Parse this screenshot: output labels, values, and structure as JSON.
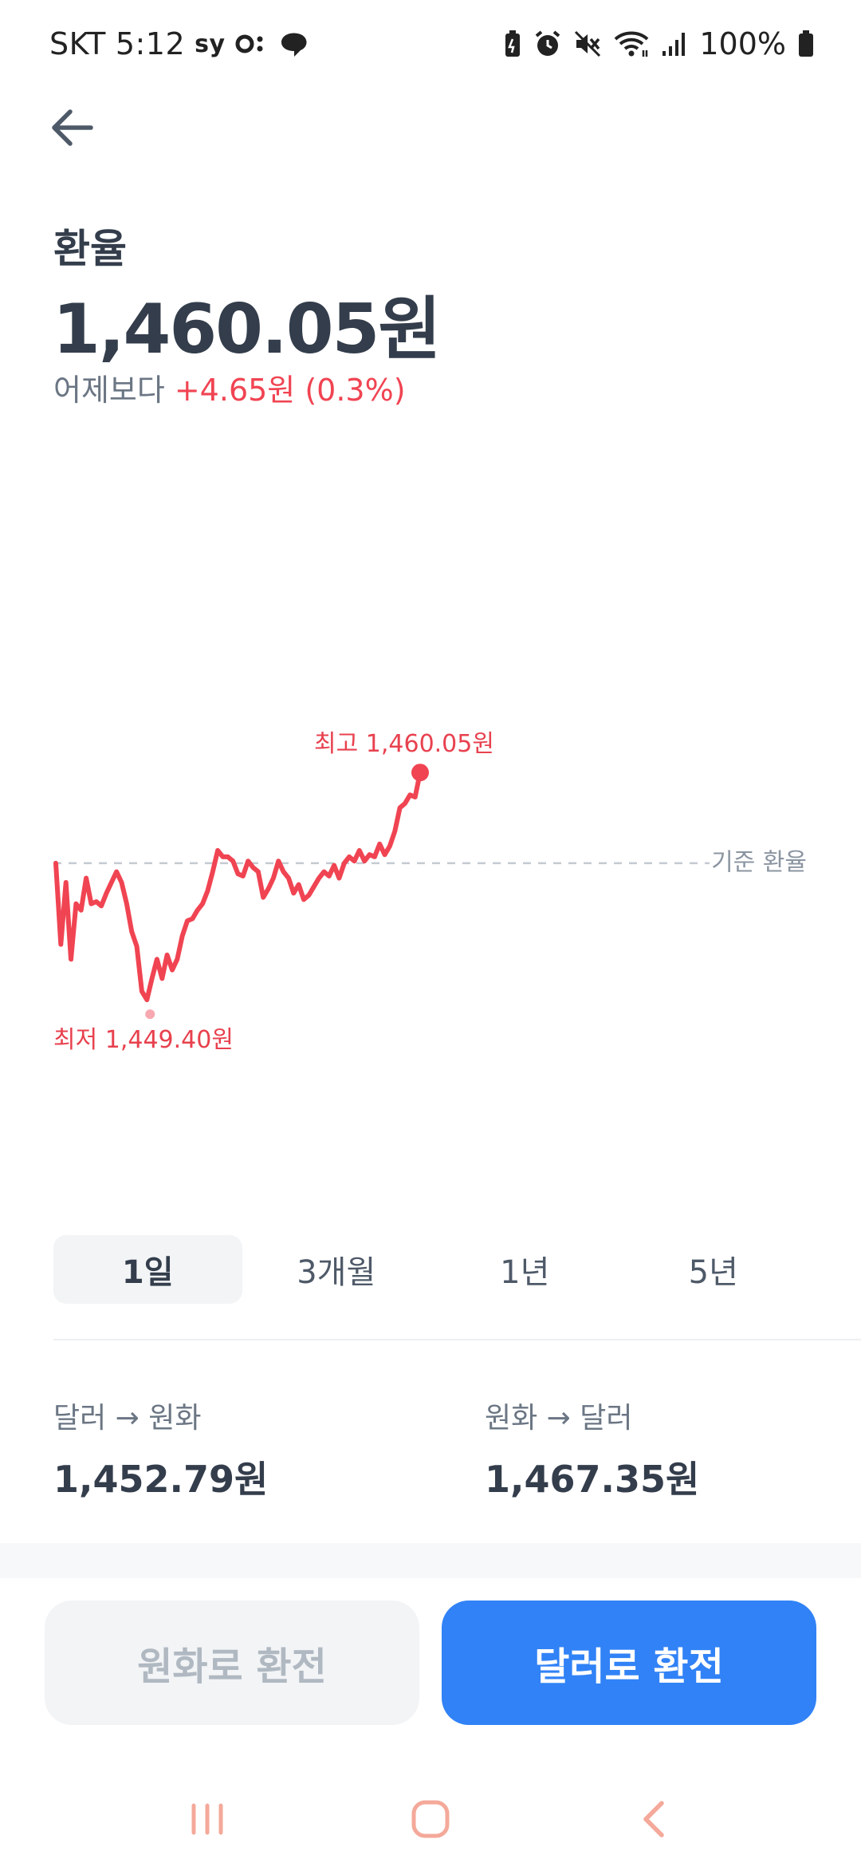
{
  "status_bar": {
    "carrier": "SKT",
    "time": "5:12",
    "left_badges": "sy",
    "battery": "100%"
  },
  "header": {
    "label": "환율",
    "rate": "1,460.05원",
    "change_prefix": "어제보다",
    "change_value": "+4.65원 (0.3%)"
  },
  "chart_data": {
    "type": "line",
    "series": [
      {
        "values": [
          1455.8,
          1452.0,
          1454.9,
          1451.3,
          1453.9,
          1453.6,
          1455.1,
          1453.9,
          1454.0,
          1453.8,
          1454.4,
          1454.9,
          1455.4,
          1454.9,
          1453.9,
          1452.6,
          1451.9,
          1449.8,
          1449.4,
          1450.4,
          1451.3,
          1450.4,
          1451.5,
          1450.8,
          1451.3,
          1452.4,
          1453.1,
          1453.2,
          1453.6,
          1453.9,
          1454.5,
          1455.4,
          1456.4,
          1456.1,
          1456.1,
          1455.9,
          1455.3,
          1455.2,
          1455.9,
          1455.6,
          1455.4,
          1454.2,
          1454.6,
          1455.1,
          1455.9,
          1455.4,
          1455.1,
          1454.4,
          1454.8,
          1454.1,
          1454.3,
          1454.7,
          1455.1,
          1455.4,
          1455.2,
          1455.7,
          1455.1,
          1455.8,
          1456.1,
          1455.9,
          1456.4,
          1455.9,
          1456.2,
          1456.1,
          1456.7,
          1456.2,
          1456.6,
          1457.3,
          1458.4,
          1458.6,
          1459.0,
          1458.9,
          1460.05
        ],
        "color": "#f04452"
      }
    ],
    "baseline": 1455.8,
    "baseline_label": "기준 환율",
    "max_label": "최고 1,460.05원",
    "min_label": "최저 1,449.40원",
    "max_value": 1460.05,
    "min_value": 1449.4,
    "ylim": [
      1446.9,
      1462.6
    ]
  },
  "tabs": [
    {
      "label": "1일",
      "active": true
    },
    {
      "label": "3개월",
      "active": false
    },
    {
      "label": "1년",
      "active": false
    },
    {
      "label": "5년",
      "active": false
    }
  ],
  "prices": {
    "usd_to_krw_label": "달러 → 원화",
    "usd_to_krw_value": "1,452.79원",
    "krw_to_usd_label": "원화 → 달러",
    "krw_to_usd_value": "1,467.35원"
  },
  "buttons": {
    "to_krw": "원화로 환전",
    "to_usd": "달러로 환전"
  },
  "colors": {
    "accent": "#3182f6",
    "up": "#f04452",
    "text": "#333d4b"
  }
}
